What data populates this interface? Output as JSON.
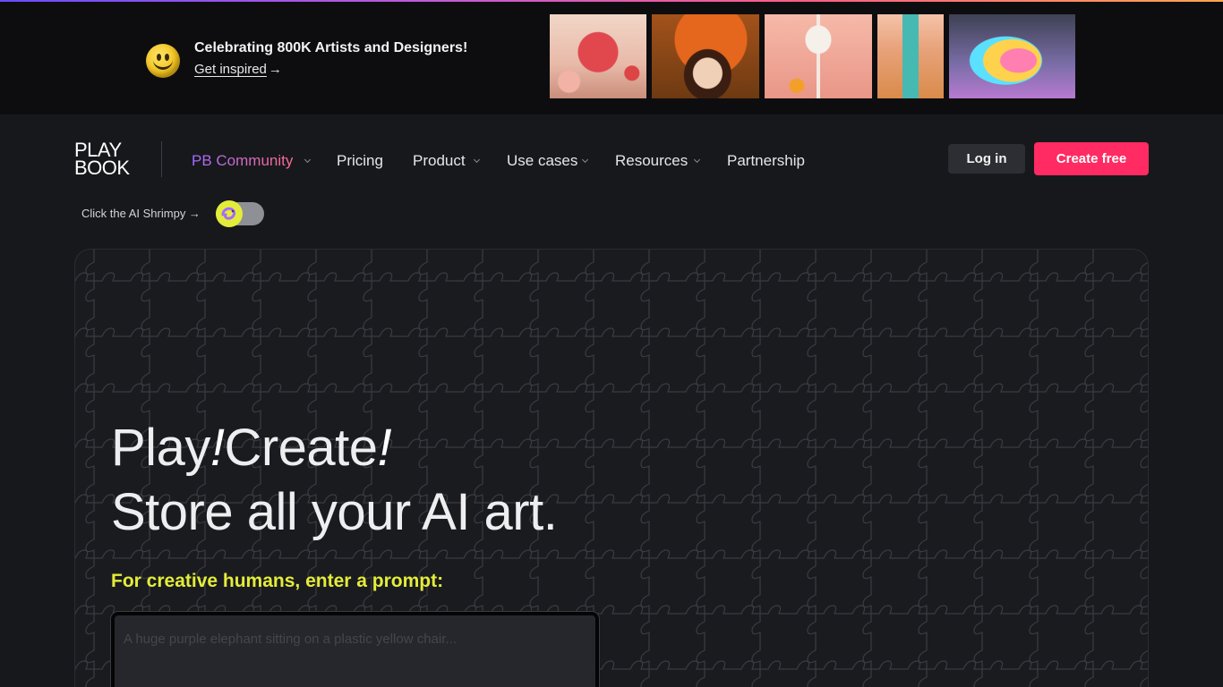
{
  "banner": {
    "title": "Celebrating 800K Artists and Designers!",
    "link_label": "Get inspired",
    "link_arrow": "→",
    "icon": "smiley-icon",
    "thumbnails": [
      "surreal-bird-art",
      "girl-with-fish-art",
      "cocktail-glass-art",
      "cosmetics-still-life-art",
      "rainbow-shrimp-art"
    ]
  },
  "logo": {
    "line1": "PLAY",
    "line2": "BOOK"
  },
  "nav": {
    "community": "PB Community",
    "pricing": "Pricing",
    "product": "Product",
    "use_cases": "Use cases",
    "resources": "Resources",
    "partnership": "Partnership"
  },
  "auth": {
    "login": "Log in",
    "create": "Create free"
  },
  "shrimpy": {
    "label": "Click the AI Shrimpy →",
    "toggle_on": false
  },
  "hero": {
    "play": "Play",
    "create": "Create",
    "bang": "!",
    "line2": "Store all your AI art.",
    "prompt_label": "For creative humans, enter a prompt:",
    "prompt_placeholder": "A huge purple elephant sitting on a plastic yellow chair..."
  },
  "colors": {
    "accent": "#ff2b62",
    "highlight": "#e4ec3a",
    "background": "#17181c",
    "banner_background": "#0d0d0f"
  }
}
